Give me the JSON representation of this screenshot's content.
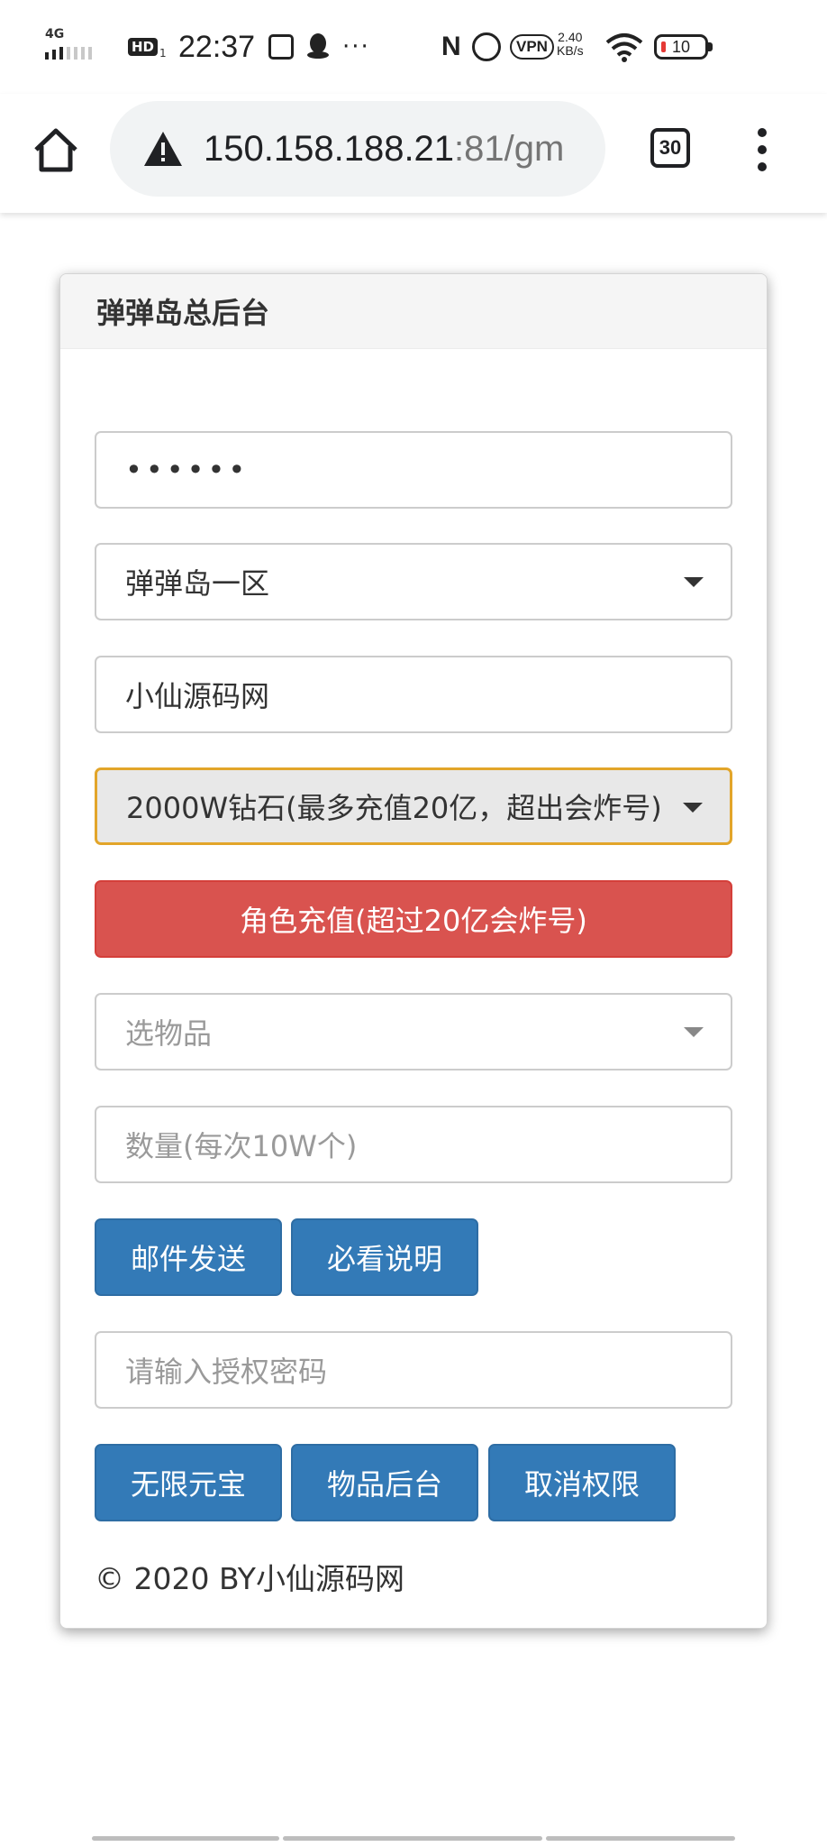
{
  "status_bar": {
    "network": "4G",
    "hd_label": "HD",
    "hd_sub": "1",
    "time": "22:37",
    "more": "···",
    "nfc": "N",
    "vpn": "VPN",
    "speed_value": "2.40",
    "speed_unit": "KB/s",
    "battery": "10"
  },
  "browser": {
    "url_host": "150.158.188.21",
    "url_rest": ":81/gm",
    "tab_count": "30"
  },
  "panel": {
    "title": "弹弹岛总后台",
    "password_value": "••••••",
    "server_select": "弹弹岛一区",
    "role_input_value": "小仙源码网",
    "recharge_select": "2000W钻石(最多充值20亿，超出会炸号)",
    "recharge_button": "角色充值(超过20亿会炸号)",
    "item_select_placeholder": "选物品",
    "quantity_placeholder": "数量(每次10W个)",
    "mail_send_button": "邮件发送",
    "must_read_button": "必看说明",
    "auth_password_placeholder": "请输入授权密码",
    "unlimited_ingot_button": "无限元宝",
    "item_admin_button": "物品后台",
    "revoke_button": "取消权限",
    "footer": "© 2020 BY小仙源码网"
  },
  "colors": {
    "danger": "#d9534f",
    "primary": "#337ab7",
    "focus_border": "#e2a52a"
  }
}
